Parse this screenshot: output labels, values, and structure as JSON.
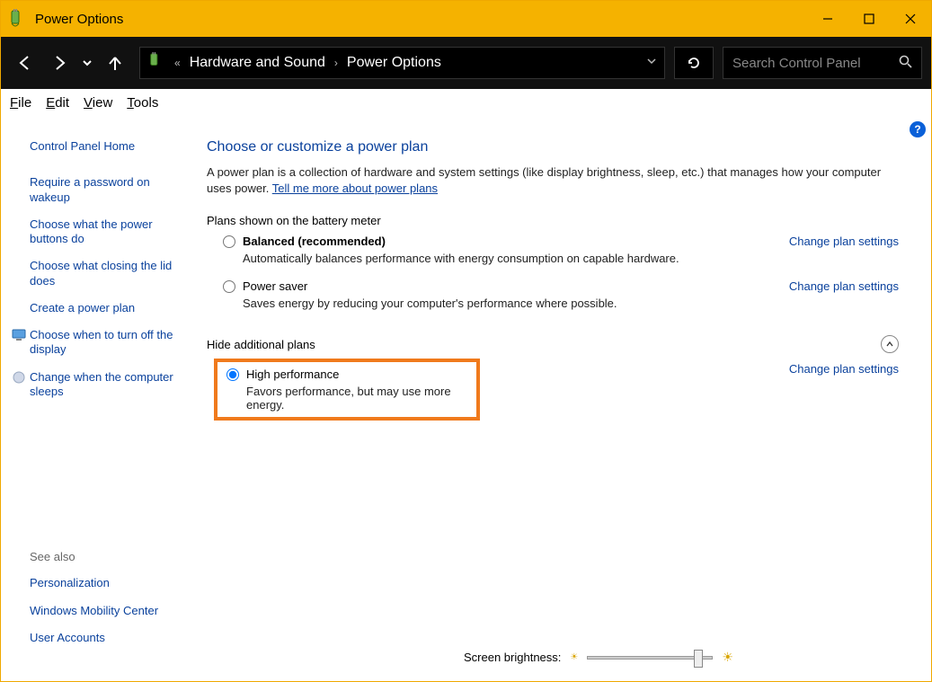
{
  "window": {
    "title": "Power Options"
  },
  "breadcrumb": {
    "parent": "Hardware and Sound",
    "current": "Power Options"
  },
  "search": {
    "placeholder": "Search Control Panel"
  },
  "menu": {
    "file": "File",
    "edit": "Edit",
    "view": "View",
    "tools": "Tools"
  },
  "sidebar": {
    "home": "Control Panel Home",
    "links": [
      "Require a password on wakeup",
      "Choose what the power buttons do",
      "Choose what closing the lid does",
      "Create a power plan",
      "Choose when to turn off the display",
      "Change when the computer sleeps"
    ],
    "seealso_label": "See also",
    "seealso": [
      "Personalization",
      "Windows Mobility Center",
      "User Accounts"
    ]
  },
  "main": {
    "heading": "Choose or customize a power plan",
    "desc_pre": "A power plan is a collection of hardware and system settings (like display brightness, sleep, etc.) that manages how your computer uses power. ",
    "desc_link": "Tell me more about power plans",
    "section_plans": "Plans shown on the battery meter",
    "change_link": "Change plan settings",
    "plan_balanced": {
      "name": "Balanced (recommended)",
      "desc": "Automatically balances performance with energy consumption on capable hardware."
    },
    "plan_saver": {
      "name": "Power saver",
      "desc": "Saves energy by reducing your computer's performance where possible."
    },
    "hide_label": "Hide additional plans",
    "plan_high": {
      "name": "High performance",
      "desc": "Favors performance, but may use more energy."
    },
    "brightness_label": "Screen brightness:"
  }
}
